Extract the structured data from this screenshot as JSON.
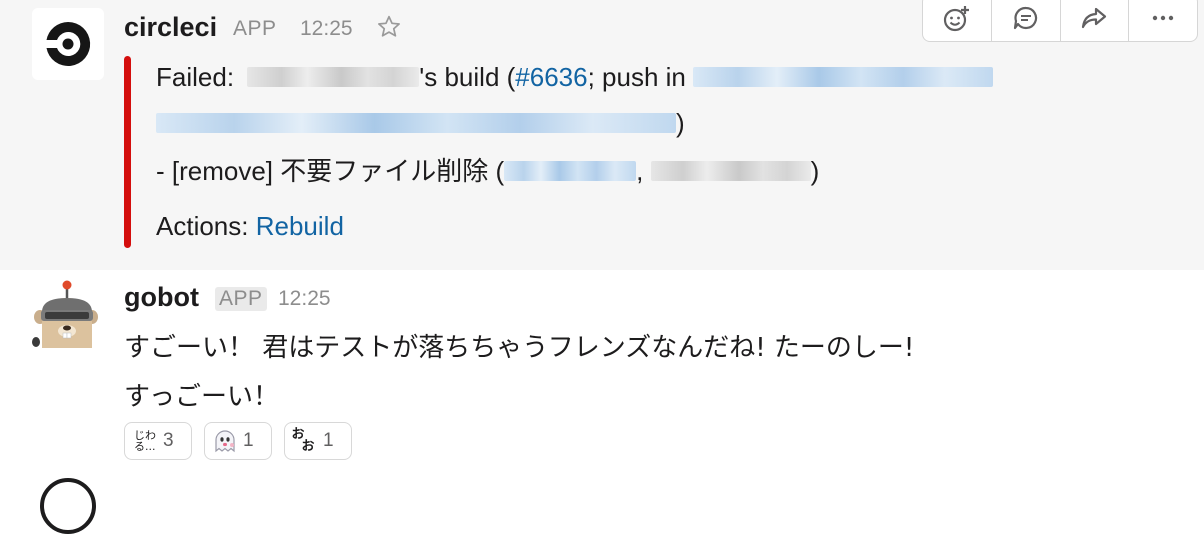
{
  "message1": {
    "sender": "circleci",
    "badge": "APP",
    "time": "12:25",
    "attachment": {
      "failed_label": "Failed:",
      "build_suffix": "'s build (",
      "build_number": "#6636",
      "push_in": "; push in",
      "close_paren": ")",
      "commit_line": "- [remove] 不要ファイル削除 (",
      "comma": ",",
      "actions_label": "Actions:",
      "rebuild_link": "Rebuild",
      "accent_color": "#d40e0d"
    }
  },
  "hover_actions": [
    "add-reaction-icon",
    "reply-thread-icon",
    "share-icon",
    "more-icon"
  ],
  "message2": {
    "sender": "gobot",
    "badge": "APP",
    "time": "12:25",
    "line1": "すごーい！ 君はテストが落ちちゃうフレンズなんだね! たーのしー!",
    "line2": "すっごーい！",
    "reactions": [
      {
        "emoji_label": "じわる...",
        "count": "3"
      },
      {
        "emoji_label": "ghost",
        "count": "1"
      },
      {
        "emoji_label": "おぉ",
        "count": "1"
      }
    ]
  },
  "reaction_texts": {
    "jiwa_line1": "じわ",
    "jiwa_line2": "る...",
    "oo_top": "お",
    "oo_bottom": "お"
  }
}
